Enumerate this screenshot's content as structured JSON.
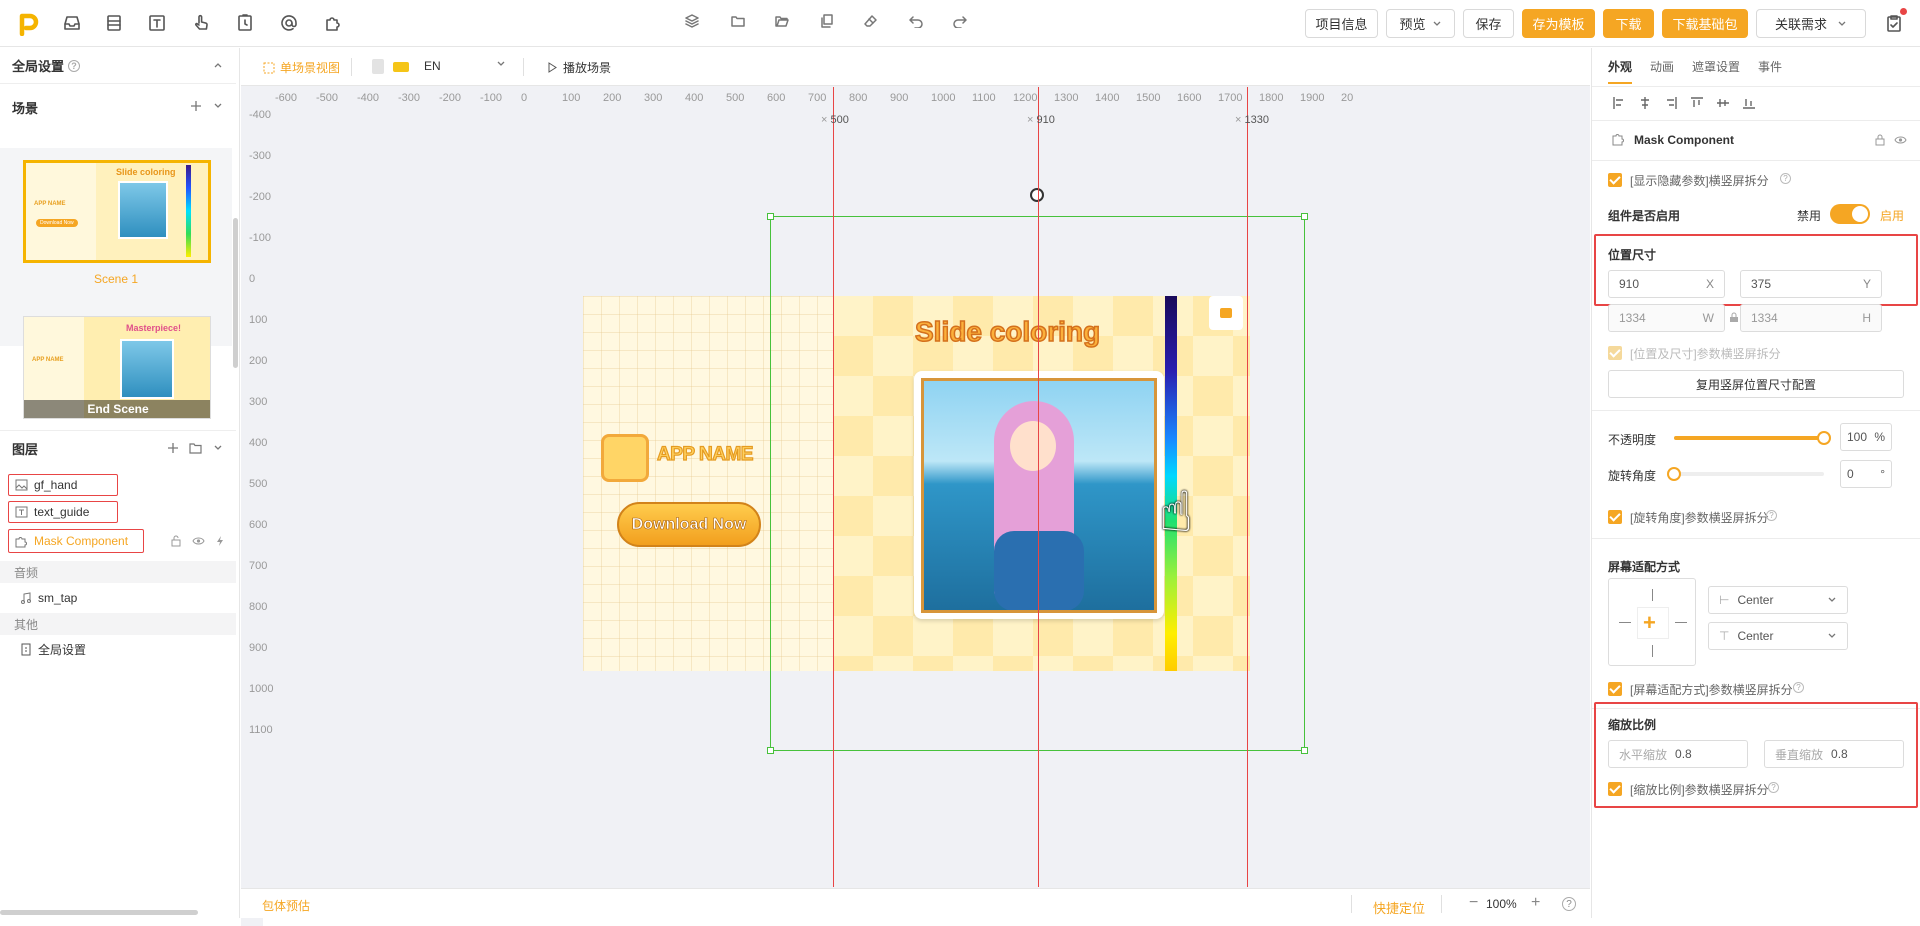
{
  "topbar": {
    "tools": [
      "logo-p",
      "inbox-icon",
      "layers-stack-icon",
      "text-icon",
      "hand-pointer-icon",
      "timer-icon",
      "at-icon",
      "puzzle-icon"
    ],
    "center_tools": [
      "stack-icon",
      "folder-icon",
      "folder-open-icon",
      "copy-icon",
      "eraser-icon",
      "undo-icon",
      "redo-icon"
    ],
    "project_info": "项目信息",
    "preview": "预览",
    "save": "保存",
    "save_template": "存为模板",
    "download": "下载",
    "download_base": "下载基础包",
    "link_demand": "关联需求"
  },
  "left": {
    "global_settings": "全局设置",
    "scenes_title": "场景",
    "scenes": [
      {
        "label": "Scene 1",
        "thumb_title": "Slide coloring",
        "selected": true
      },
      {
        "label": "End Scene",
        "thumb_title": "Masterpiece!",
        "selected": false
      }
    ],
    "layers_title": "图层",
    "layers": [
      {
        "label": "gf_hand",
        "icon": "image-icon"
      },
      {
        "label": "text_guide",
        "icon": "text-icon"
      },
      {
        "label": "Mask Component",
        "icon": "puzzle-icon",
        "active": true
      }
    ],
    "audio_title": "音频",
    "audio_item": "sm_tap",
    "other_title": "其他",
    "other_item": "全局设置",
    "thumb_small_text": {
      "app": "APP NAME",
      "dl": "Download Now"
    }
  },
  "canvas": {
    "view_mode": "单场景视图",
    "lang": "EN",
    "play": "播放场景",
    "h_ticks": [
      "-600",
      "-500",
      "-400",
      "-300",
      "-200",
      "-100",
      "0",
      "100",
      "200",
      "300",
      "400",
      "500",
      "600",
      "700",
      "800",
      "900",
      "1000",
      "1100",
      "1200",
      "1300",
      "1400",
      "1500",
      "1600",
      "1700",
      "1800",
      "1900",
      "20"
    ],
    "v_ticks": [
      "-400",
      "-300",
      "-200",
      "-100",
      "0",
      "100",
      "200",
      "300",
      "400",
      "500",
      "600",
      "700",
      "800",
      "900",
      "1000",
      "1100"
    ],
    "guides": [
      "500",
      "910",
      "1330"
    ],
    "scene": {
      "title": "Slide coloring",
      "app_name": "APP NAME",
      "download": "Download Now"
    },
    "footer_left": "包体预估",
    "quick_locate": "快捷定位",
    "zoom": "100%"
  },
  "right": {
    "tabs": [
      "外观",
      "动画",
      "遮罩设置",
      "事件"
    ],
    "component_name": "Mask Component",
    "show_hidden": "[显示隐藏参数]横竖屏拆分",
    "enabled_label": "组件是否启用",
    "disable": "禁用",
    "enable": "启用",
    "pos_title": "位置尺寸",
    "x": "910",
    "y": "375",
    "w": "1334",
    "h": "1334",
    "x_lbl": "X",
    "y_lbl": "Y",
    "w_lbl": "W",
    "h_lbl": "H",
    "pos_split": "[位置及尺寸]参数横竖屏拆分",
    "reuse": "复用竖屏位置尺寸配置",
    "opacity_label": "不透明度",
    "opacity": "100",
    "pct": "%",
    "opacity_fraction": 1.0,
    "rotation_label": "旋转角度",
    "rotation": "0",
    "deg": "°",
    "rot_split": "[旋转角度]参数横竖屏拆分",
    "fit_title": "屏幕适配方式",
    "h_align": "Center",
    "v_align": "Center",
    "fit_split": "[屏幕适配方式]参数横竖屏拆分",
    "scale_title": "缩放比例",
    "hscale_lbl": "水平缩放",
    "hscale": "0.8",
    "vscale_lbl": "垂直缩放",
    "vscale": "0.8",
    "scale_split": "[缩放比例]参数横竖屏拆分"
  },
  "colors": {
    "accent": "#f5a623",
    "red": "#e84545",
    "green": "#47c13b"
  }
}
